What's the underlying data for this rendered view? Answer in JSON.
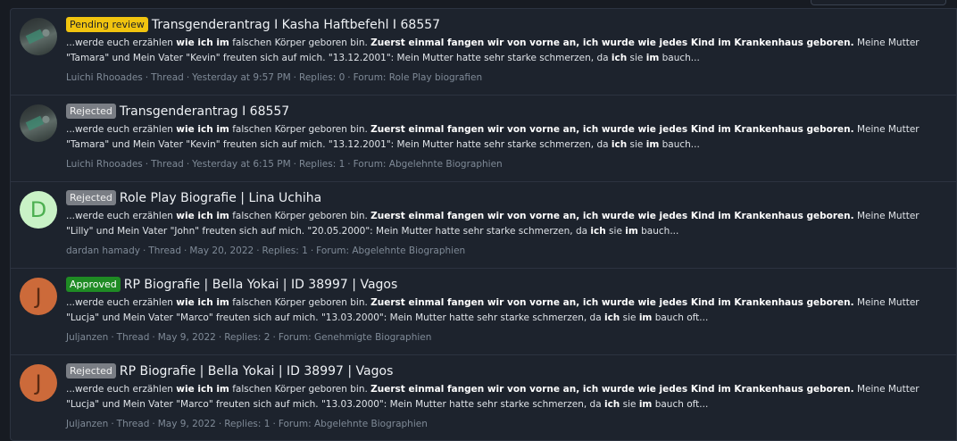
{
  "results": [
    {
      "avatar": {
        "type": "image",
        "icon": "user-avatar-image"
      },
      "badge": {
        "label": "Pending review",
        "kind": "pending"
      },
      "title": "Transgenderantrag I Kasha Haftbefehl I 68557",
      "snippet": [
        {
          "t": "...werde euch erzählen ",
          "b": false
        },
        {
          "t": "wie ich im",
          "b": true
        },
        {
          "t": " falschen Körper geboren bin. ",
          "b": false
        },
        {
          "t": "Zuerst einmal fangen wir von vorne an, ich wurde wie jedes Kind im Krankenhaus geboren.",
          "b": true
        },
        {
          "t": " Meine Mutter \"Tamara\" und Mein Vater \"Kevin\" freuten sich auf mich. \"13.12.2001\": Mein Mutter hatte sehr starke schmerzen, da ",
          "b": false
        },
        {
          "t": "ich",
          "b": true
        },
        {
          "t": " sie ",
          "b": false
        },
        {
          "t": "im",
          "b": true
        },
        {
          "t": " bauch...",
          "b": false
        }
      ],
      "meta": {
        "author": "Luichi Rhooades",
        "type": "Thread",
        "date": "Yesterday at 9:57 PM",
        "replies": "Replies: 0",
        "forum": "Forum: Role Play biografien"
      }
    },
    {
      "avatar": {
        "type": "image",
        "icon": "user-avatar-image"
      },
      "badge": {
        "label": "Rejected",
        "kind": "rejected"
      },
      "title": "Transgenderantrag I 68557",
      "snippet": [
        {
          "t": "...werde euch erzählen ",
          "b": false
        },
        {
          "t": "wie ich im",
          "b": true
        },
        {
          "t": " falschen Körper geboren bin. ",
          "b": false
        },
        {
          "t": "Zuerst einmal fangen wir von vorne an, ich wurde wie jedes Kind im Krankenhaus geboren.",
          "b": true
        },
        {
          "t": " Meine Mutter \"Tamara\" und Mein Vater \"Kevin\" freuten sich auf mich. \"13.12.2001\": Mein Mutter hatte sehr starke schmerzen, da ",
          "b": false
        },
        {
          "t": "ich",
          "b": true
        },
        {
          "t": " sie ",
          "b": false
        },
        {
          "t": "im",
          "b": true
        },
        {
          "t": " bauch...",
          "b": false
        }
      ],
      "meta": {
        "author": "Luichi Rhooades",
        "type": "Thread",
        "date": "Yesterday at 6:15 PM",
        "replies": "Replies: 1",
        "forum": "Forum: Abgelehnte Biographien"
      }
    },
    {
      "avatar": {
        "type": "letter",
        "letter": "D",
        "bg": "#c9f2c6",
        "fg": "#4caf50"
      },
      "badge": {
        "label": "Rejected",
        "kind": "rejected"
      },
      "title": "Role Play Biografie | Lina Uchiha",
      "snippet": [
        {
          "t": "...werde euch erzählen ",
          "b": false
        },
        {
          "t": "wie ich im",
          "b": true
        },
        {
          "t": " falschen Körper geboren bin. ",
          "b": false
        },
        {
          "t": "Zuerst einmal fangen wir von vorne an, ich wurde wie jedes Kind im Krankenhaus geboren.",
          "b": true
        },
        {
          "t": " Meine Mutter \"Lilly\" und Mein Vater \"John\" freuten sich auf mich. \"20.05.2000\": Mein Mutter hatte sehr starke schmerzen, da ",
          "b": false
        },
        {
          "t": "ich",
          "b": true
        },
        {
          "t": " sie ",
          "b": false
        },
        {
          "t": "im",
          "b": true
        },
        {
          "t": " bauch...",
          "b": false
        }
      ],
      "meta": {
        "author": "dardan hamady",
        "type": "Thread",
        "date": "May 20, 2022",
        "replies": "Replies: 1",
        "forum": "Forum: Abgelehnte Biographien"
      }
    },
    {
      "avatar": {
        "type": "letter",
        "letter": "J",
        "bg": "#cc6a3a",
        "fg": "#5a2a12"
      },
      "badge": {
        "label": "Approved",
        "kind": "approved"
      },
      "title": "RP Biografie | Bella Yokai | ID 38997 | Vagos",
      "snippet": [
        {
          "t": "...werde euch erzählen ",
          "b": false
        },
        {
          "t": "wie ich im",
          "b": true
        },
        {
          "t": " falschen Körper geboren bin. ",
          "b": false
        },
        {
          "t": "Zuerst einmal fangen wir von vorne an, ich wurde wie jedes Kind im Krankenhaus geboren.",
          "b": true
        },
        {
          "t": " Meine Mutter \"Lucja\" und Mein Vater \"Marco\" freuten sich auf mich. \"13.03.2000\": Mein Mutter hatte sehr starke schmerzen, da ",
          "b": false
        },
        {
          "t": "ich",
          "b": true
        },
        {
          "t": " sie ",
          "b": false
        },
        {
          "t": "im",
          "b": true
        },
        {
          "t": " bauch oft...",
          "b": false
        }
      ],
      "meta": {
        "author": "Juljanzen",
        "type": "Thread",
        "date": "May 9, 2022",
        "replies": "Replies: 2",
        "forum": "Forum: Genehmigte Biographien"
      }
    },
    {
      "avatar": {
        "type": "letter",
        "letter": "J",
        "bg": "#cc6a3a",
        "fg": "#5a2a12"
      },
      "badge": {
        "label": "Rejected",
        "kind": "rejected"
      },
      "title": "RP Biografie | Bella Yokai | ID 38997 | Vagos",
      "snippet": [
        {
          "t": "...werde euch erzählen ",
          "b": false
        },
        {
          "t": "wie ich im",
          "b": true
        },
        {
          "t": " falschen Körper geboren bin. ",
          "b": false
        },
        {
          "t": "Zuerst einmal fangen wir von vorne an, ich wurde wie jedes Kind im Krankenhaus geboren.",
          "b": true
        },
        {
          "t": " Meine Mutter \"Lucja\" und Mein Vater \"Marco\" freuten sich auf mich. \"13.03.2000\": Mein Mutter hatte sehr starke schmerzen, da ",
          "b": false
        },
        {
          "t": "ich",
          "b": true
        },
        {
          "t": " sie ",
          "b": false
        },
        {
          "t": "im",
          "b": true
        },
        {
          "t": " bauch oft...",
          "b": false
        }
      ],
      "meta": {
        "author": "Juljanzen",
        "type": "Thread",
        "date": "May 9, 2022",
        "replies": "Replies: 1",
        "forum": "Forum: Abgelehnte Biographien"
      }
    }
  ]
}
